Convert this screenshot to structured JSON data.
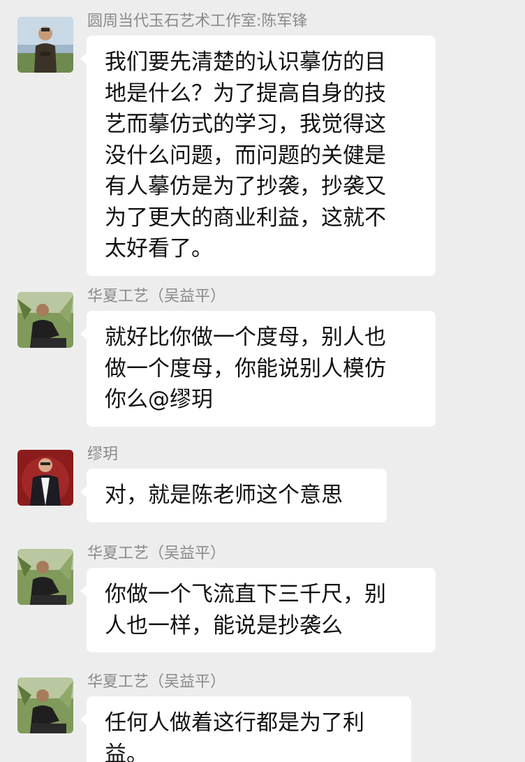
{
  "messages": [
    {
      "sender": "圆周当代玉石艺术工作室:陈军锋",
      "lines": [
        "我们要先清楚的认识摹仿的目",
        "地是什么？为了提高自身的技",
        "艺而摹仿式的学习，我觉得这",
        "没什么问题，而问题的关健是",
        "有人摹仿是为了抄袭，抄袭又",
        "为了更大的商业利益，这就不",
        "太好看了。"
      ],
      "avatar": "avatar-chen"
    },
    {
      "sender": "华夏工艺（吴益平）",
      "lines": [
        "就好比你做一个度母，别人也",
        "做一个度母，你能说别人模仿",
        "你么@缪玥"
      ],
      "avatar": "avatar-wu"
    },
    {
      "sender": "缪玥",
      "lines": [
        "对，就是陈老师这个意思"
      ],
      "avatar": "avatar-miao"
    },
    {
      "sender": "华夏工艺（吴益平）",
      "lines": [
        "你做一个飞流直下三千尺，别",
        "人也一样，能说是抄袭么"
      ],
      "avatar": "avatar-wu"
    },
    {
      "sender": "华夏工艺（吴益平）",
      "lines": [
        "任何人做着这行都是为了利",
        "益。"
      ],
      "avatar": "avatar-wu"
    }
  ]
}
